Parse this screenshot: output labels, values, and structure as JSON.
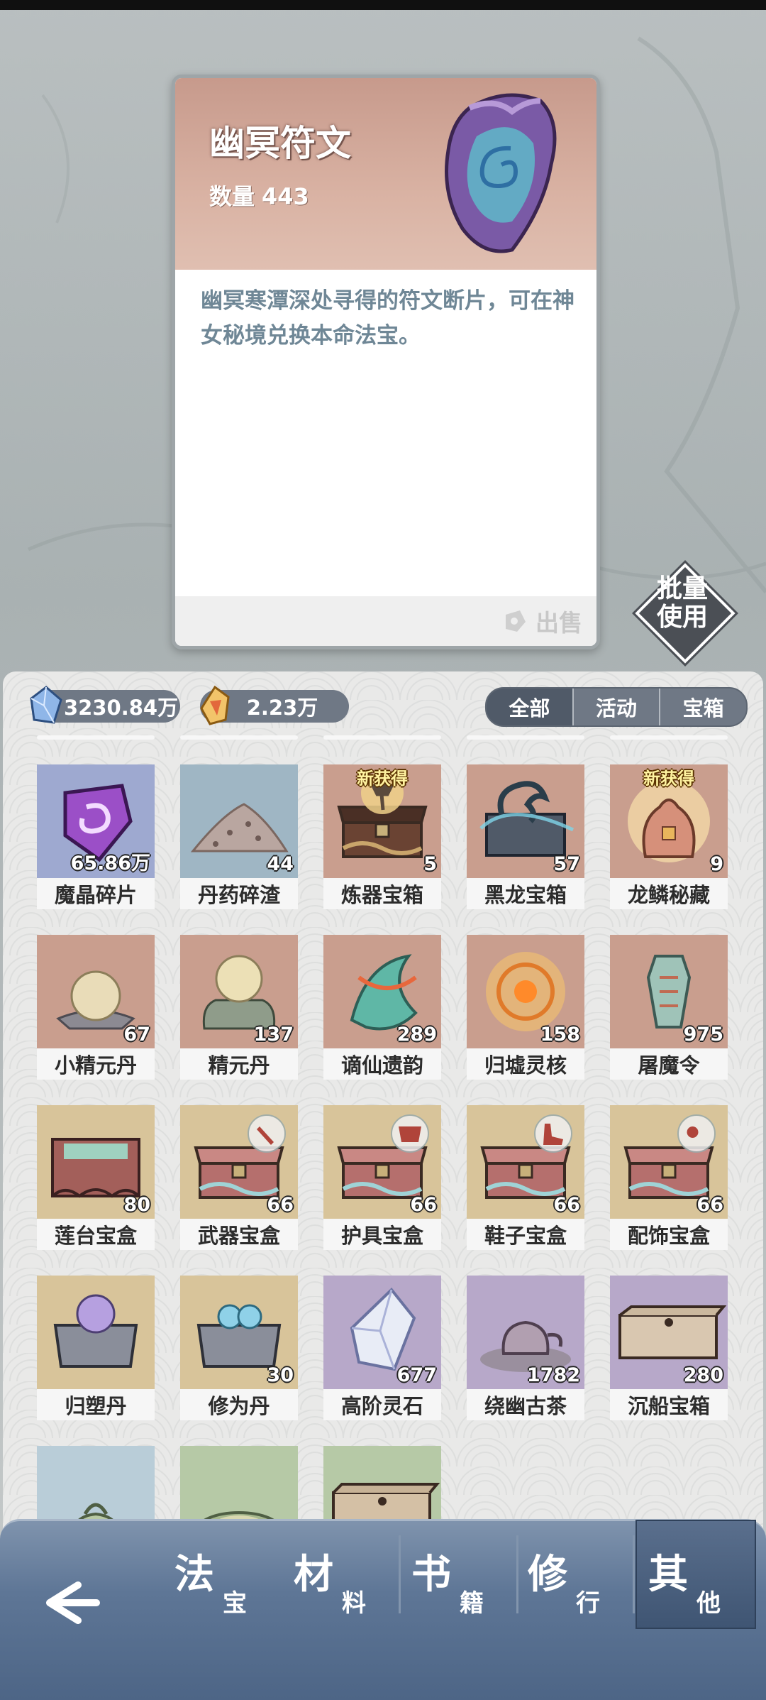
{
  "selected_item": {
    "name": "幽冥符文",
    "quantity_label": "数量",
    "quantity": "443",
    "description": "幽冥寒潭深处寻得的符文断片，可在神女秘境兑换本命法宝。",
    "sell_label": "出售"
  },
  "batch_use": {
    "line1": "批量",
    "line2": "使用"
  },
  "currencies": [
    {
      "name": "blue-crystal",
      "value": "3230.84万"
    },
    {
      "name": "gold-crystal",
      "value": "2.23万"
    }
  ],
  "filter_tabs": [
    {
      "label": "全部",
      "selected": true
    },
    {
      "label": "活动",
      "selected": false
    },
    {
      "label": "宝箱",
      "selected": false
    }
  ],
  "items": [
    {
      "name": "魔晶碎片",
      "count": "65.86万",
      "bg": "#9ea9d0",
      "icon": "purple-crystal-icon",
      "new": ""
    },
    {
      "name": "丹药碎渣",
      "count": "44",
      "bg": "#9fb6c4",
      "icon": "rubble-pile-icon",
      "new": ""
    },
    {
      "name": "炼器宝箱",
      "count": "5",
      "bg": "#c99e8e",
      "icon": "forge-chest-icon",
      "new": "新获得"
    },
    {
      "name": "黑龙宝箱",
      "count": "57",
      "bg": "#c99e8e",
      "icon": "black-dragon-chest-icon",
      "new": ""
    },
    {
      "name": "龙鳞秘藏",
      "count": "9",
      "bg": "#c99e8e",
      "icon": "dragon-scale-bag-icon",
      "new": "新获得"
    },
    {
      "name": "小精元丹",
      "count": "67",
      "bg": "#c99e8e",
      "icon": "small-orb-icon",
      "new": ""
    },
    {
      "name": "精元丹",
      "count": "137",
      "bg": "#c99e8e",
      "icon": "orb-on-stand-icon",
      "new": ""
    },
    {
      "name": "谪仙遗韵",
      "count": "289",
      "bg": "#c99e8e",
      "icon": "immortal-relic-icon",
      "new": ""
    },
    {
      "name": "归墟灵核",
      "count": "158",
      "bg": "#c99e8e",
      "icon": "glowing-core-icon",
      "new": ""
    },
    {
      "name": "屠魔令",
      "count": "975",
      "bg": "#c99e8e",
      "icon": "demon-token-icon",
      "new": ""
    },
    {
      "name": "莲台宝盒",
      "count": "80",
      "bg": "#d8c49a",
      "icon": "lotus-box-icon",
      "new": ""
    },
    {
      "name": "武器宝盒",
      "count": "66",
      "bg": "#d8c49a",
      "icon": "weapon-box-icon",
      "new": ""
    },
    {
      "name": "护具宝盒",
      "count": "66",
      "bg": "#d8c49a",
      "icon": "armor-box-icon",
      "new": ""
    },
    {
      "name": "鞋子宝盒",
      "count": "66",
      "bg": "#d8c49a",
      "icon": "shoes-box-icon",
      "new": ""
    },
    {
      "name": "配饰宝盒",
      "count": "66",
      "bg": "#d8c49a",
      "icon": "accessory-box-icon",
      "new": ""
    },
    {
      "name": "归塑丹",
      "count": "",
      "bg": "#d8c49a",
      "icon": "purple-pill-chest-icon",
      "new": ""
    },
    {
      "name": "修为丹",
      "count": "30",
      "bg": "#d8c49a",
      "icon": "blue-pill-chest-icon",
      "new": ""
    },
    {
      "name": "高阶灵石",
      "count": "677",
      "bg": "#b7a8c9",
      "icon": "spirit-stone-icon",
      "new": ""
    },
    {
      "name": "绕幽古茶",
      "count": "1782",
      "bg": "#b7a8c9",
      "icon": "teapot-icon",
      "new": ""
    },
    {
      "name": "沉船宝箱",
      "count": "280",
      "bg": "#b7a8c9",
      "icon": "wooden-chest-icon",
      "new": ""
    },
    {
      "name": "",
      "count": "",
      "bg": "#b9cdd8",
      "icon": "green-teapot-icon",
      "new": ""
    },
    {
      "name": "",
      "count": "",
      "bg": "#b6c9a6",
      "icon": "tea-bowl-icon",
      "new": ""
    },
    {
      "name": "",
      "count": "",
      "bg": "#b6c9a6",
      "icon": "long-chest-icon",
      "new": ""
    }
  ],
  "nav_tabs": [
    {
      "big": "法",
      "small": "宝",
      "selected": false
    },
    {
      "big": "材",
      "small": "料",
      "selected": false
    },
    {
      "big": "书",
      "small": "籍",
      "selected": false
    },
    {
      "big": "修",
      "small": "行",
      "selected": false
    },
    {
      "big": "其",
      "small": "他",
      "selected": true
    }
  ],
  "colors": {
    "panel_bg": "#e9e9e8",
    "currency_pill": "#6f7885",
    "nav_bg": "#5e7696",
    "description_text": "#6f8796"
  }
}
